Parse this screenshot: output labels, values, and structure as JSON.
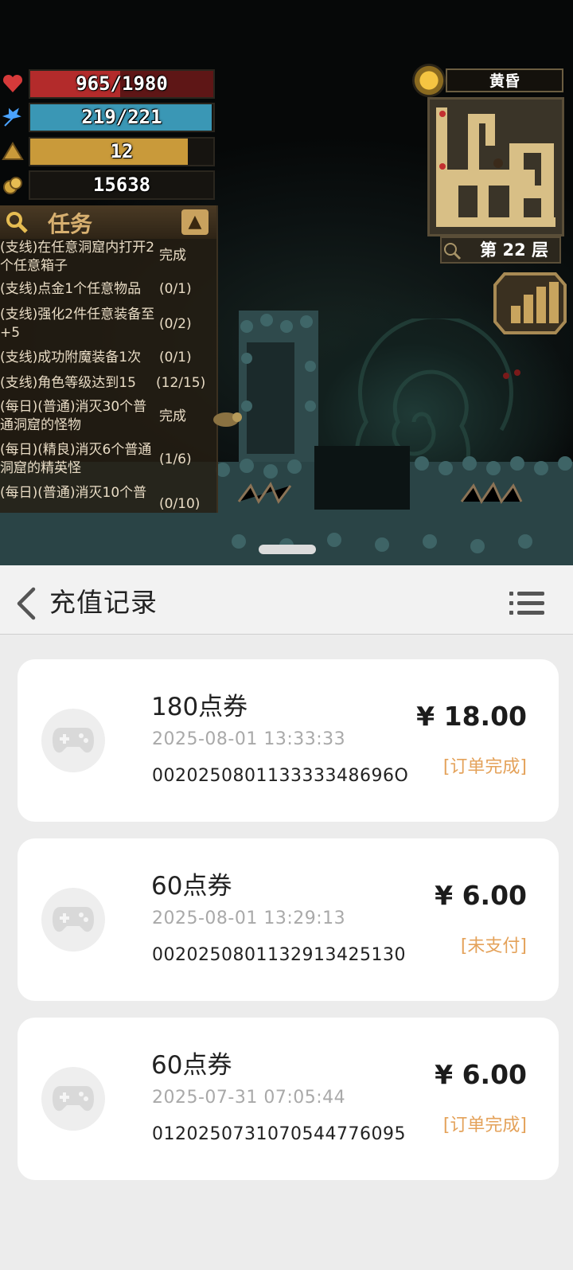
{
  "game": {
    "stats": {
      "hp": "965/1980",
      "mp": "219/221",
      "level": "12",
      "gold": "15638",
      "hp_fill": 0.49,
      "mp_fill": 0.99,
      "level_fill": 0.86
    },
    "quest": {
      "title": "任务",
      "items": [
        {
          "text": "(支线)在任意洞窟内打开2个任意箱子",
          "status": "完成"
        },
        {
          "text": "(支线)点金1个任意物品",
          "status": "(0/1)"
        },
        {
          "text": "(支线)强化2件任意装备至+5",
          "status": "(0/2)"
        },
        {
          "text": "(支线)成功附魔装备1次",
          "status": "(0/1)"
        },
        {
          "text": "(支线)角色等级达到15",
          "status": "(12/15)"
        },
        {
          "text": "(每日)(普通)消灭30个普通洞窟的怪物",
          "status": "完成"
        },
        {
          "text": "(每日)(精良)消灭6个普通洞窟的精英怪",
          "status": "(1/6)"
        },
        {
          "text": "(每日)(普通)消灭10个普",
          "status": "(0/10)"
        }
      ]
    },
    "time_of_day": "黄昏",
    "floor": "第 22 层"
  },
  "header": {
    "title": "充值记录"
  },
  "records": [
    {
      "name": "180点券",
      "time": "2025-08-01 13:33:33",
      "order": "002025080113333348696O",
      "amount": "¥ 18.00",
      "status": "[订单完成]"
    },
    {
      "name": "60点券",
      "time": "2025-08-01 13:29:13",
      "order": "0020250801132913425130",
      "amount": "¥ 6.00",
      "status": "[未支付]"
    },
    {
      "name": "60点券",
      "time": "2025-07-31 07:05:44",
      "order": "0120250731070544776095",
      "amount": "¥ 6.00",
      "status": "[订单完成]"
    }
  ],
  "colors": {
    "hp": "#b32b2b",
    "mp": "#3a97b5",
    "level": "#c99a3a",
    "status_accent": "#e4a25a"
  }
}
